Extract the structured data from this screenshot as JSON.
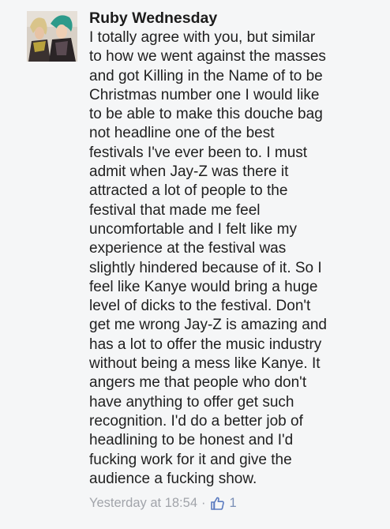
{
  "comment": {
    "author": "Ruby Wednesday",
    "lines": [
      "I totally agree with you, but similar",
      "to how we went against the masses",
      "and got Killing in the Name of to be",
      "Christmas number one I would like",
      "to be able to make this douche bag",
      "not headline one of the best",
      "festivals I've ever been to. I must",
      "admit when Jay-Z was there it",
      "attracted a lot of people to the",
      "festival that made me feel",
      "uncomfortable and I felt like my",
      "experience at the festival was",
      "slightly hindered because of it. So I",
      "feel like Kanye would bring a huge",
      "level of dicks to the festival. Don't",
      "get me wrong Jay-Z is amazing and",
      "has a lot to offer the music industry",
      "without being a mess like Kanye. It",
      "angers me that people who don't",
      "have anything to offer get such",
      "recognition. I'd do a better job of",
      "headlining to be honest and I'd",
      "fucking work for it and give the",
      "audience a fucking show."
    ],
    "timestamp": "Yesterday at 18:54",
    "separator": "·",
    "like_icon": "thumbs-up-icon",
    "like_count": "1"
  },
  "colors": {
    "background": "#f5f6f7",
    "author": "#1c1c1c",
    "text": "#1f1f1f",
    "meta": "#a1a4aa",
    "like_blue": "#5b7bc0"
  }
}
